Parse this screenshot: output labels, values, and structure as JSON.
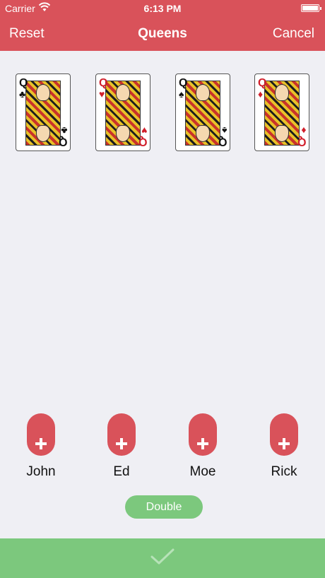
{
  "status": {
    "carrier": "Carrier",
    "time": "6:13 PM"
  },
  "nav": {
    "left": "Reset",
    "title": "Queens",
    "right": "Cancel"
  },
  "cards": [
    {
      "rank": "Q",
      "suit": "♣",
      "color": "black"
    },
    {
      "rank": "Q",
      "suit": "♥",
      "color": "red"
    },
    {
      "rank": "Q",
      "suit": "♠",
      "color": "black"
    },
    {
      "rank": "Q",
      "suit": "♦",
      "color": "red"
    }
  ],
  "players": [
    {
      "name": "John"
    },
    {
      "name": "Ed"
    },
    {
      "name": "Moe"
    },
    {
      "name": "Rick"
    }
  ],
  "double_label": "Double",
  "colors": {
    "accent": "#d9525a",
    "confirm": "#7cc87d",
    "background": "#efeff4"
  }
}
